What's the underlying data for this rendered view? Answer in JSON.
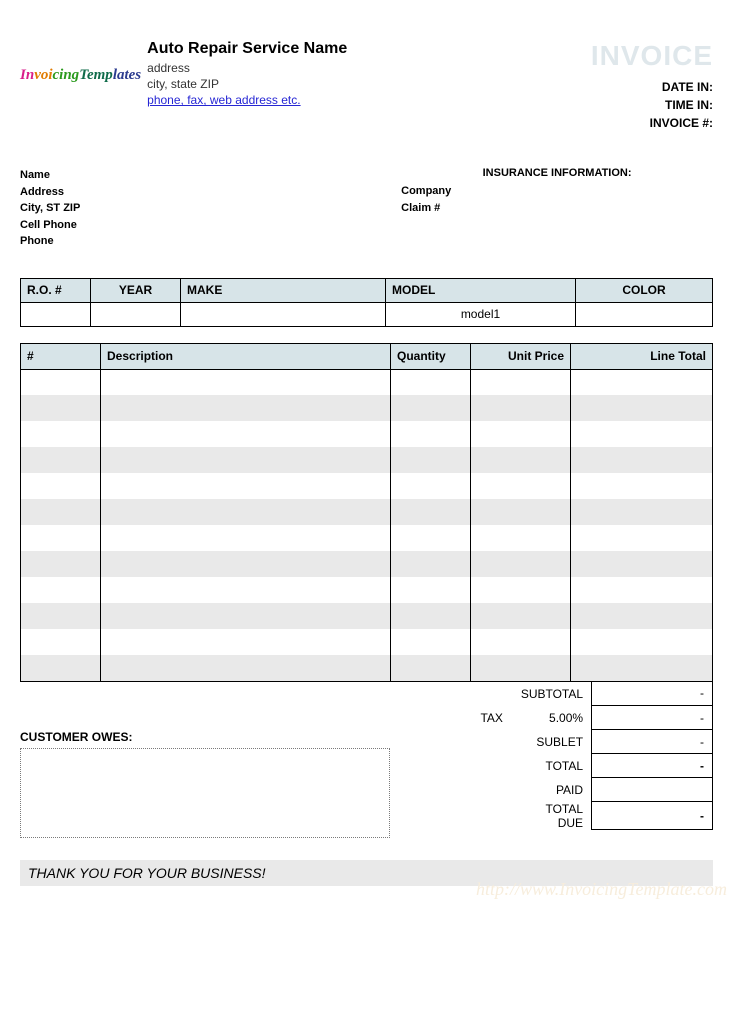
{
  "header": {
    "logo_text": "InvoicingTemplates",
    "business_title": "Auto Repair Service Name",
    "address_line1": "address",
    "address_line2": "city, state ZIP",
    "contact_link": "phone, fax, web address etc.",
    "invoice_word": "INVOICE",
    "meta": {
      "date_in_label": "DATE IN:",
      "time_in_label": "TIME IN:",
      "invoice_num_label": "INVOICE #:"
    }
  },
  "customer": {
    "name_label": "Name",
    "address_label": "Address",
    "city_label": "City, ST ZIP",
    "cell_label": "Cell Phone",
    "phone_label": "Phone"
  },
  "insurance": {
    "title": "INSURANCE INFORMATION:",
    "company_label": "Company",
    "claim_label": "Claim #"
  },
  "vehicle": {
    "headers": {
      "ro": "R.O. #",
      "year": "YEAR",
      "make": "MAKE",
      "model": "MODEL",
      "color": "COLOR"
    },
    "row": {
      "ro": "",
      "year": "",
      "make": "",
      "model": "model1",
      "color": ""
    }
  },
  "items": {
    "headers": {
      "num": "#",
      "desc": "Description",
      "qty": "Quantity",
      "unit": "Unit Price",
      "total": "Line Total"
    },
    "row_count": 12
  },
  "totals": {
    "tax_label": "TAX",
    "subtotal_label": "SUBTOTAL",
    "tax_rate": "5.00%",
    "sublet_label": "SUBLET",
    "total_label": "TOTAL",
    "paid_label": "PAID",
    "total_due_label": "TOTAL DUE",
    "subtotal_value": "-",
    "tax_value": "-",
    "sublet_value": "-",
    "total_value": "-",
    "paid_value": "",
    "total_due_value": "-",
    "customer_owes_label": "CUSTOMER OWES:"
  },
  "footer": {
    "thanks": "THANK YOU FOR YOUR BUSINESS!",
    "watermark": "http://www.InvoicingTemplate.com"
  }
}
